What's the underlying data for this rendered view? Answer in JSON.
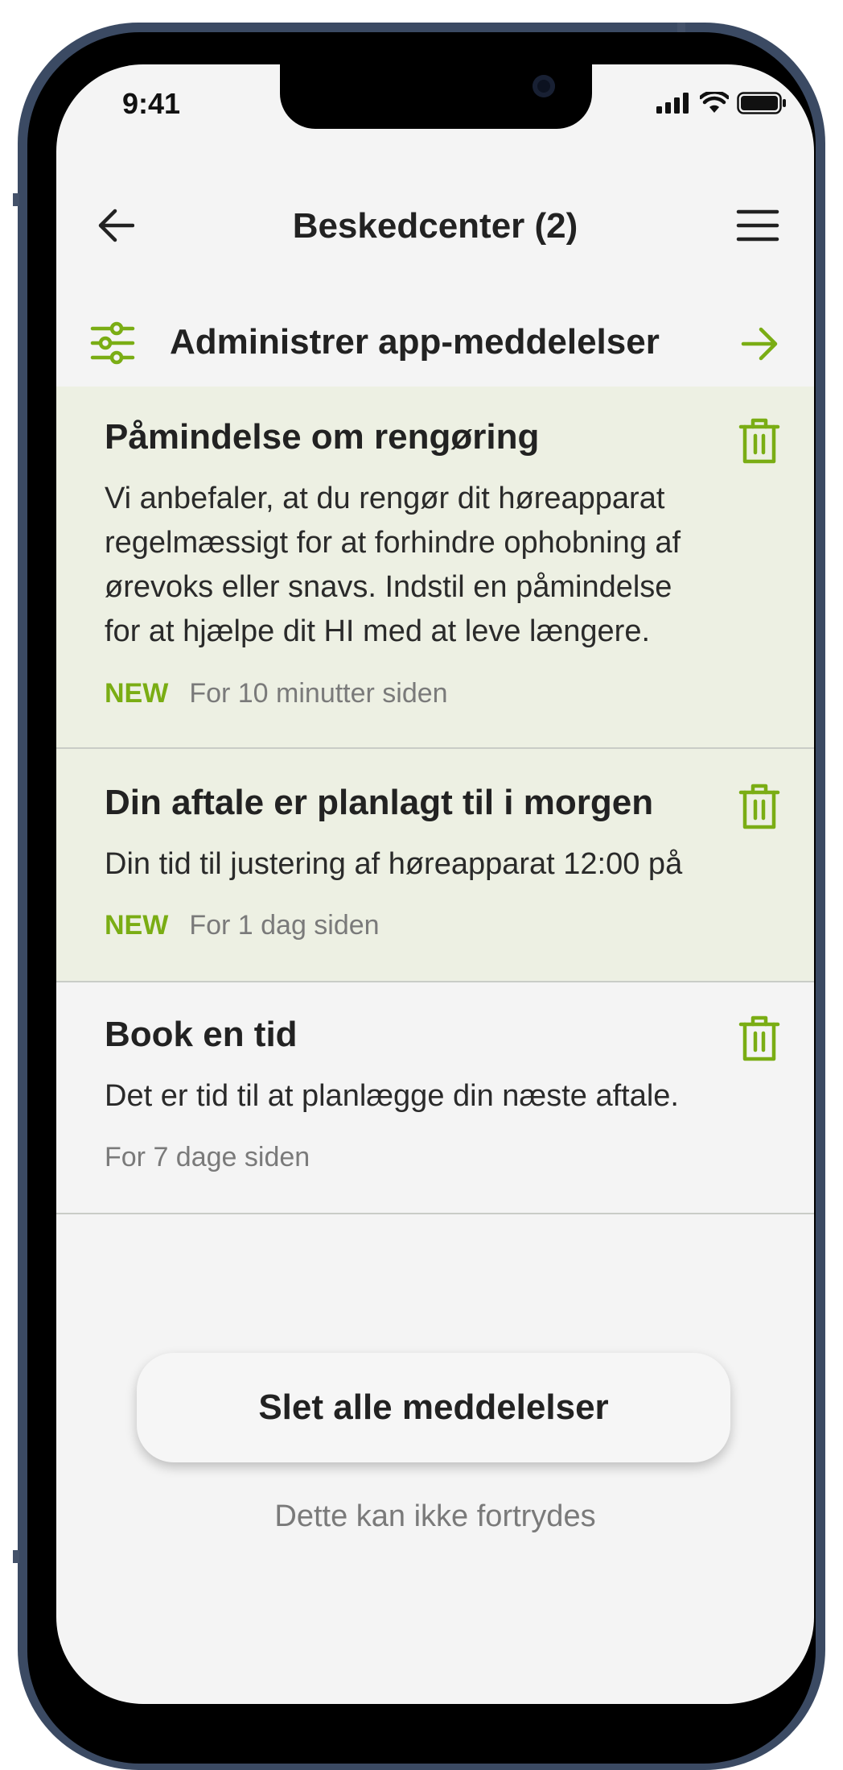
{
  "status_bar": {
    "time": "9:41"
  },
  "header": {
    "title": "Beskedcenter (2)",
    "back_icon": "arrow-left-icon",
    "menu_icon": "hamburger-menu-icon"
  },
  "manage": {
    "label": "Administrer app-meddelelser",
    "icon": "sliders-icon",
    "arrow_icon": "arrow-right-icon"
  },
  "messages": [
    {
      "title": "Påmindelse om rengøring",
      "body_lines": [
        "Vi anbefaler, at du rengør dit høreapparat",
        "regelmæssigt for at forhindre ophobning af",
        "ørevoks eller snavs. Indstil en påmindelse",
        "for at hjælpe dit HI med at leve længere."
      ],
      "badge": "NEW",
      "time": "For 10 minutter siden",
      "unread": true
    },
    {
      "title": "Din aftale er planlagt til i morgen",
      "body_lines": [
        "Din tid til justering af høreapparat 12:00 på"
      ],
      "badge": "NEW",
      "time": "For 1 dag siden",
      "unread": true
    },
    {
      "title": "Book en tid",
      "body_lines": [
        "Det er tid til at planlægge din næste aftale."
      ],
      "badge": "",
      "time": "For 7 dage siden",
      "unread": false
    }
  ],
  "footer": {
    "delete_all_label": "Slet alle meddelelser",
    "note": "Dette kan ikke fortrydes"
  },
  "colors": {
    "accent": "#7aad14",
    "unread_bg": "#edf0e3",
    "screen_bg": "#f4f4f4",
    "frame": "#3b4a63"
  }
}
